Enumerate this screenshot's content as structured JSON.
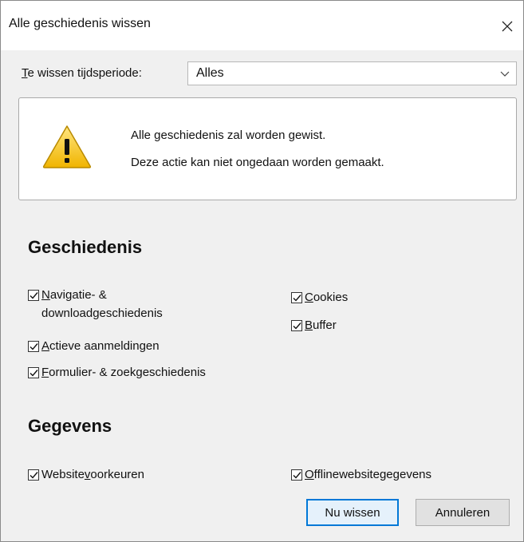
{
  "window": {
    "title": "Alle geschiedenis wissen"
  },
  "period": {
    "label_prefix": "T",
    "label_rest": "e wissen tijdsperiode:",
    "selected": "Alles"
  },
  "warning": {
    "line1": "Alle geschiedenis zal worden gewist.",
    "line2": "Deze actie kan niet ongedaan worden gemaakt."
  },
  "history": {
    "title": "Geschiedenis",
    "items": [
      {
        "key": "N",
        "rest": "avigatie- &\ndownloadgeschiedenis",
        "checked": true
      },
      {
        "key": "A",
        "rest": "ctieve aanmeldingen",
        "checked": true
      },
      {
        "key": "F",
        "rest": "ormulier- & zoekgeschiedenis",
        "checked": true
      },
      {
        "key": "C",
        "rest": "ookies",
        "checked": true
      },
      {
        "key": "B",
        "rest": "uffer",
        "checked": true
      }
    ]
  },
  "data_section": {
    "title": "Gegevens",
    "items": [
      {
        "pre": "Website",
        "key": "v",
        "rest": "oorkeuren",
        "checked": true
      },
      {
        "pre": "",
        "key": "O",
        "rest": "fflinewebsitegegevens",
        "checked": true
      }
    ]
  },
  "buttons": {
    "confirm": "Nu wissen",
    "cancel": "Annuleren"
  },
  "colors": {
    "accent": "#0078d7",
    "background": "#f0f0f0",
    "warning_yellow": "#f2c200"
  }
}
